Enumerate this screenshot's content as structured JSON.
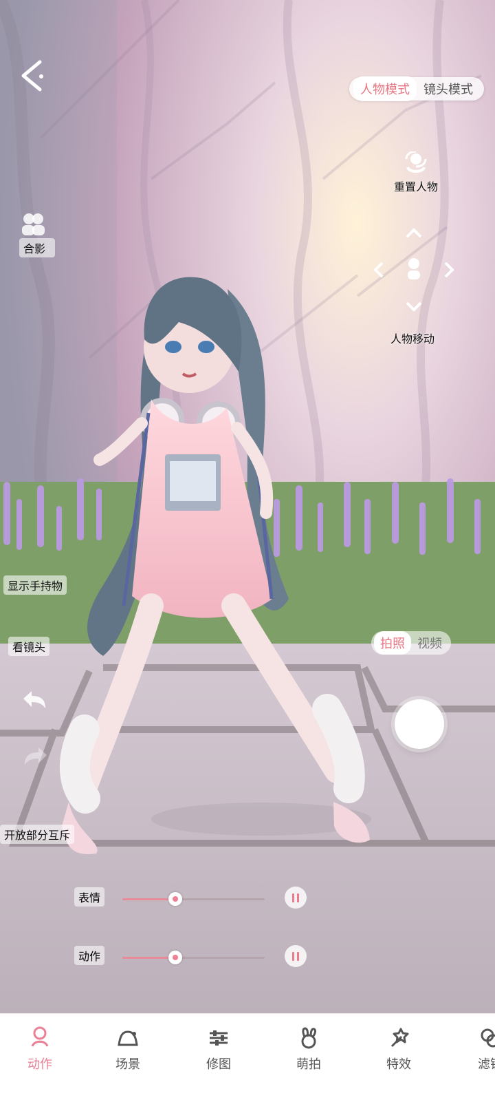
{
  "mode_switch": {
    "tabs": [
      "人物模式",
      "镜头模式"
    ]
  },
  "left_controls": {
    "group_photo": "合影",
    "show_handheld": "显示手持物",
    "look_at_camera": "看镜头",
    "open_interaction": "开放部分互斥"
  },
  "right_controls": {
    "reset_character": "重置人物",
    "character_move": "人物移动"
  },
  "capture_mode": {
    "tabs": [
      "拍照",
      "视频"
    ]
  },
  "sliders": [
    {
      "label": "表情",
      "value": 0.37
    },
    {
      "label": "动作",
      "value": 0.37
    }
  ],
  "toolbar": {
    "items": [
      {
        "label": "动作",
        "icon": "pose-icon"
      },
      {
        "label": "场景",
        "icon": "scene-icon"
      },
      {
        "label": "修图",
        "icon": "adjust-icon"
      },
      {
        "label": "萌拍",
        "icon": "rabbit-icon"
      },
      {
        "label": "特效",
        "icon": "magic-wand-icon"
      },
      {
        "label": "滤镜",
        "icon": "filter-icon"
      }
    ]
  },
  "colors": {
    "accent": "#e97583",
    "toolbar_active": "#eb7f93"
  }
}
